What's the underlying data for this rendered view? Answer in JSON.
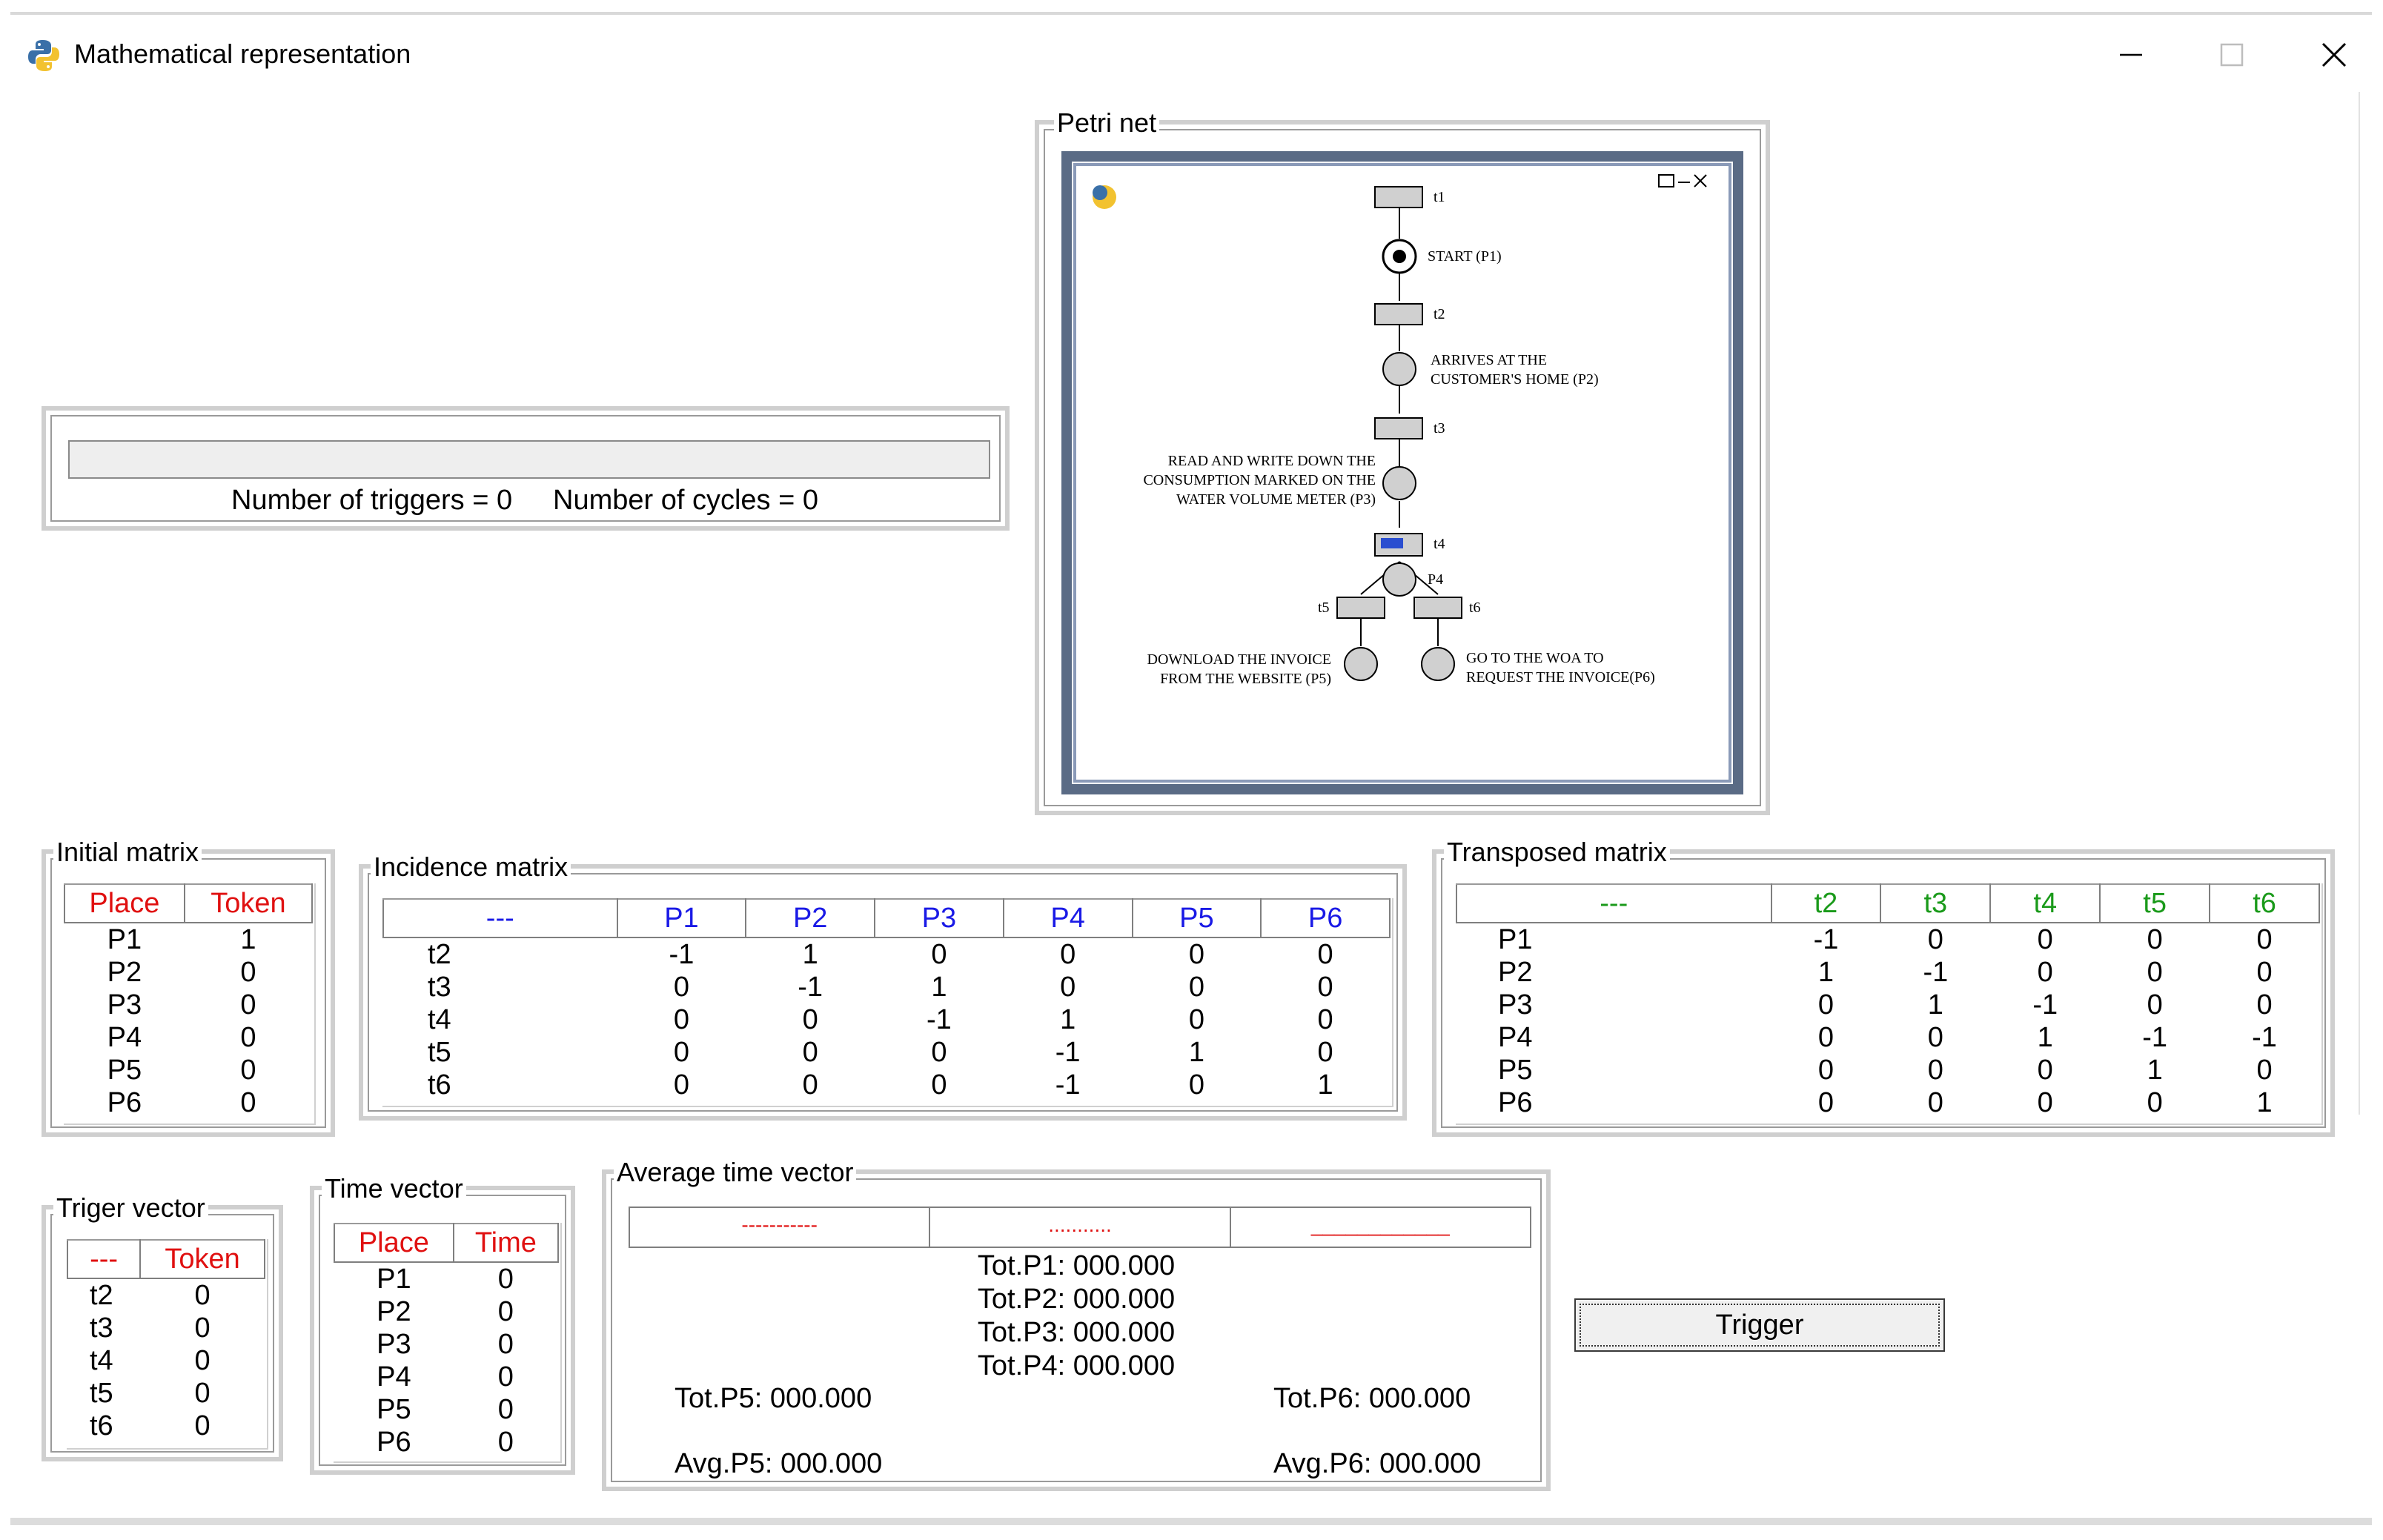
{
  "window": {
    "title": "Mathematical representation",
    "icon": "python-icon"
  },
  "progress": {
    "triggers_text": "Number of triggers = 0",
    "cycles_text": "Number of cycles = 0",
    "fraction": 0.0
  },
  "petri": {
    "label": "Petri net",
    "transitions": [
      "t1",
      "t2",
      "t3",
      "t4",
      "t5",
      "t6"
    ],
    "places": {
      "p1": "START (P1)",
      "p2_line1": "ARRIVES AT THE",
      "p2_line2": "CUSTOMER'S HOME (P2)",
      "p3_line1": "READ AND WRITE DOWN THE",
      "p3_line2": "CONSUMPTION MARKED ON THE",
      "p3_line3": "WATER VOLUME METER (P3)",
      "p4": "P4",
      "p5_line1": "DOWNLOAD THE INVOICE",
      "p5_line2": "FROM THE WEBSITE (P5)",
      "p6_line1": "GO TO THE WOA TO",
      "p6_line2": "REQUEST THE INVOICE(P6)"
    }
  },
  "initial_matrix": {
    "label": "Initial matrix",
    "headers": [
      "Place",
      "Token"
    ],
    "rows": [
      [
        "P1",
        "1"
      ],
      [
        "P2",
        "0"
      ],
      [
        "P3",
        "0"
      ],
      [
        "P4",
        "0"
      ],
      [
        "P5",
        "0"
      ],
      [
        "P6",
        "0"
      ]
    ]
  },
  "incidence_matrix": {
    "label": "Incidence matrix",
    "headers": [
      "---",
      "P1",
      "P2",
      "P3",
      "P4",
      "P5",
      "P6"
    ],
    "rows": [
      [
        "t2",
        "-1",
        "1",
        "0",
        "0",
        "0",
        "0"
      ],
      [
        "t3",
        "0",
        "-1",
        "1",
        "0",
        "0",
        "0"
      ],
      [
        "t4",
        "0",
        "0",
        "-1",
        "1",
        "0",
        "0"
      ],
      [
        "t5",
        "0",
        "0",
        "0",
        "-1",
        "1",
        "0"
      ],
      [
        "t6",
        "0",
        "0",
        "0",
        "-1",
        "0",
        "1"
      ]
    ]
  },
  "transposed_matrix": {
    "label": "Transposed matrix",
    "headers": [
      "---",
      "t2",
      "t3",
      "t4",
      "t5",
      "t6"
    ],
    "rows": [
      [
        "P1",
        "-1",
        "0",
        "0",
        "0",
        "0"
      ],
      [
        "P2",
        "1",
        "-1",
        "0",
        "0",
        "0"
      ],
      [
        "P3",
        "0",
        "1",
        "-1",
        "0",
        "0"
      ],
      [
        "P4",
        "0",
        "0",
        "1",
        "-1",
        "-1"
      ],
      [
        "P5",
        "0",
        "0",
        "0",
        "1",
        "0"
      ],
      [
        "P6",
        "0",
        "0",
        "0",
        "0",
        "1"
      ]
    ]
  },
  "trigger_vector": {
    "label": "Triger vector",
    "headers": [
      "---",
      "Token"
    ],
    "rows": [
      [
        "t2",
        "0"
      ],
      [
        "t3",
        "0"
      ],
      [
        "t4",
        "0"
      ],
      [
        "t5",
        "0"
      ],
      [
        "t6",
        "0"
      ]
    ]
  },
  "time_vector": {
    "label": "Time vector",
    "headers": [
      "Place",
      "Time"
    ],
    "rows": [
      [
        "P1",
        "0"
      ],
      [
        "P2",
        "0"
      ],
      [
        "P3",
        "0"
      ],
      [
        "P4",
        "0"
      ],
      [
        "P5",
        "0"
      ],
      [
        "P6",
        "0"
      ]
    ]
  },
  "average_time_vector": {
    "label": "Average time vector",
    "header_marks": [
      "-----------",
      "...........",
      "____________"
    ],
    "tot_p1": "Tot.P1: 000.000",
    "tot_p2": "Tot.P2: 000.000",
    "tot_p3": "Tot.P3: 000.000",
    "tot_p4": "Tot.P4: 000.000",
    "tot_p5": "Tot.P5: 000.000",
    "tot_p6": "Tot.P6: 000.000",
    "avg_p5": "Avg.P5: 000.000",
    "avg_p6": "Avg.P6: 000.000"
  },
  "trigger_button": {
    "label": "Trigger"
  },
  "colors": {
    "header_red": "#e01010",
    "header_blue": "#1a1ae6",
    "header_green": "#1a9a1a",
    "canvas_frame": "#5a6b85"
  }
}
